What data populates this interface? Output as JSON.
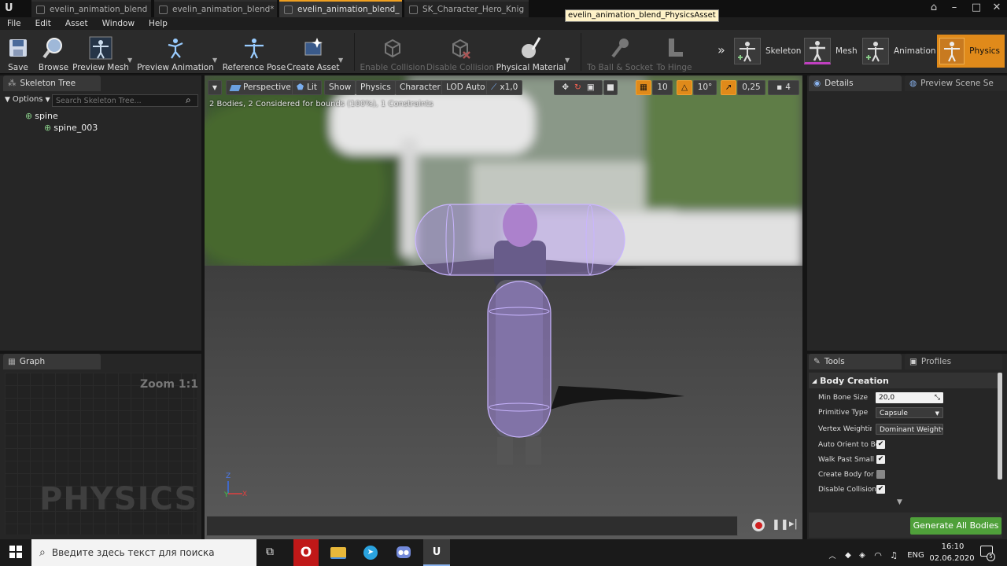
{
  "tabs": [
    {
      "label": "evelin_animation_blend"
    },
    {
      "label": "evelin_animation_blend*"
    },
    {
      "label": "evelin_animation_blend_"
    },
    {
      "label": "SK_Character_Hero_Knig"
    }
  ],
  "tooltip": "evelin_animation_blend_PhysicsAsset",
  "menu": [
    "File",
    "Edit",
    "Asset",
    "Window",
    "Help"
  ],
  "toolbar": {
    "save": "Save",
    "browse": "Browse",
    "preview_mesh": "Preview Mesh",
    "preview_animation": "Preview Animation",
    "reference_pose": "Reference Pose",
    "create_asset": "Create Asset",
    "enable_collision": "Enable Collision",
    "disable_collision": "Disable Collision",
    "physical_material": "Physical Material",
    "to_ball_socket": "To Ball & Socket",
    "to_hinge": "To Hinge"
  },
  "modes": {
    "skeleton": "Skeleton",
    "mesh": "Mesh",
    "animation": "Animation",
    "physics": "Physics"
  },
  "skeleton_tree": {
    "title": "Skeleton Tree",
    "options": "Options",
    "search_placeholder": "Search Skeleton Tree...",
    "bones": [
      "spine",
      "spine_003"
    ]
  },
  "graph": {
    "title": "Graph",
    "zoom": "Zoom 1:1",
    "watermark": "PHYSICS"
  },
  "viewport": {
    "perspective": "Perspective",
    "lit": "Lit",
    "show": "Show",
    "physics": "Physics",
    "character": "Character",
    "lod": "LOD Auto",
    "speed": "x1,0",
    "grid_snap": "10",
    "rot_snap": "10°",
    "scale_snap": "0,25",
    "cam_speed": "4",
    "info": "2 Bodies, 2 Considered for bounds (100%), 1 Constraints",
    "axis_z": "Z",
    "axis_y": "Y",
    "axis_x": "X"
  },
  "details": {
    "title": "Details",
    "preview": "Preview Scene Se"
  },
  "tools": {
    "title": "Tools",
    "profiles": "Profiles",
    "section": "Body Creation",
    "min_bone_size_label": "Min Bone Size",
    "min_bone_size": "20,0",
    "primitive_type_label": "Primitive Type",
    "primitive_type": "Capsule",
    "vertex_weighting_label": "Vertex Weighting T",
    "vertex_weighting": "Dominant Weight",
    "auto_orient_label": "Auto Orient to Bon",
    "walk_past_label": "Walk Past Small B",
    "create_body_label": "Create Body for Al",
    "disable_collisions_label": "Disable Collisions",
    "generate_button": "Generate All Bodies",
    "checks": {
      "auto_orient": true,
      "walk_past": true,
      "create_body": false,
      "disable_collisions": true
    }
  },
  "taskbar": {
    "search_placeholder": "Введите здесь текст для поиска",
    "lang": "ENG",
    "time": "16:10",
    "date": "02.06.2020",
    "notif_count": "5"
  },
  "colors": {
    "accent": "#f0a020",
    "generate": "#4fa03a",
    "capsule": "#a78be8"
  }
}
